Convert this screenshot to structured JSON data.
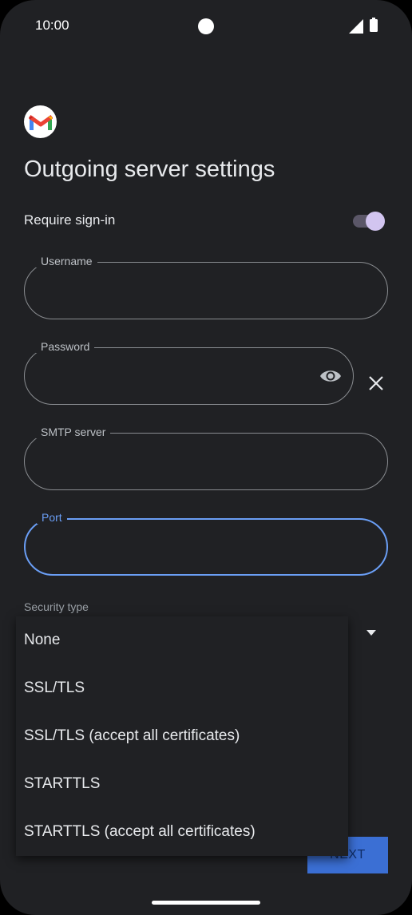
{
  "status_bar": {
    "time": "10:00"
  },
  "header": {
    "title": "Outgoing server settings"
  },
  "require_sign_in": {
    "label": "Require sign-in",
    "enabled": true
  },
  "fields": {
    "username": {
      "label": "Username",
      "value": ""
    },
    "password": {
      "label": "Password",
      "value": ""
    },
    "smtp_server": {
      "label": "SMTP server",
      "value": ""
    },
    "port": {
      "label": "Port",
      "value": ""
    }
  },
  "security_type": {
    "label": "Security type",
    "selected": "None",
    "options": [
      "None",
      "SSL/TLS",
      "SSL/TLS (accept all certificates)",
      "STARTTLS",
      "STARTTLS (accept all certificates)"
    ]
  },
  "footer": {
    "next_label": "NEXT"
  },
  "colors": {
    "accent": "#6a9ef5",
    "toggle_thumb": "#d2c5f0",
    "background": "#202124",
    "next_button": "#3b6fd4"
  },
  "icons": [
    "gmail-logo",
    "eye-icon",
    "close-icon",
    "dropdown-arrow-icon"
  ]
}
